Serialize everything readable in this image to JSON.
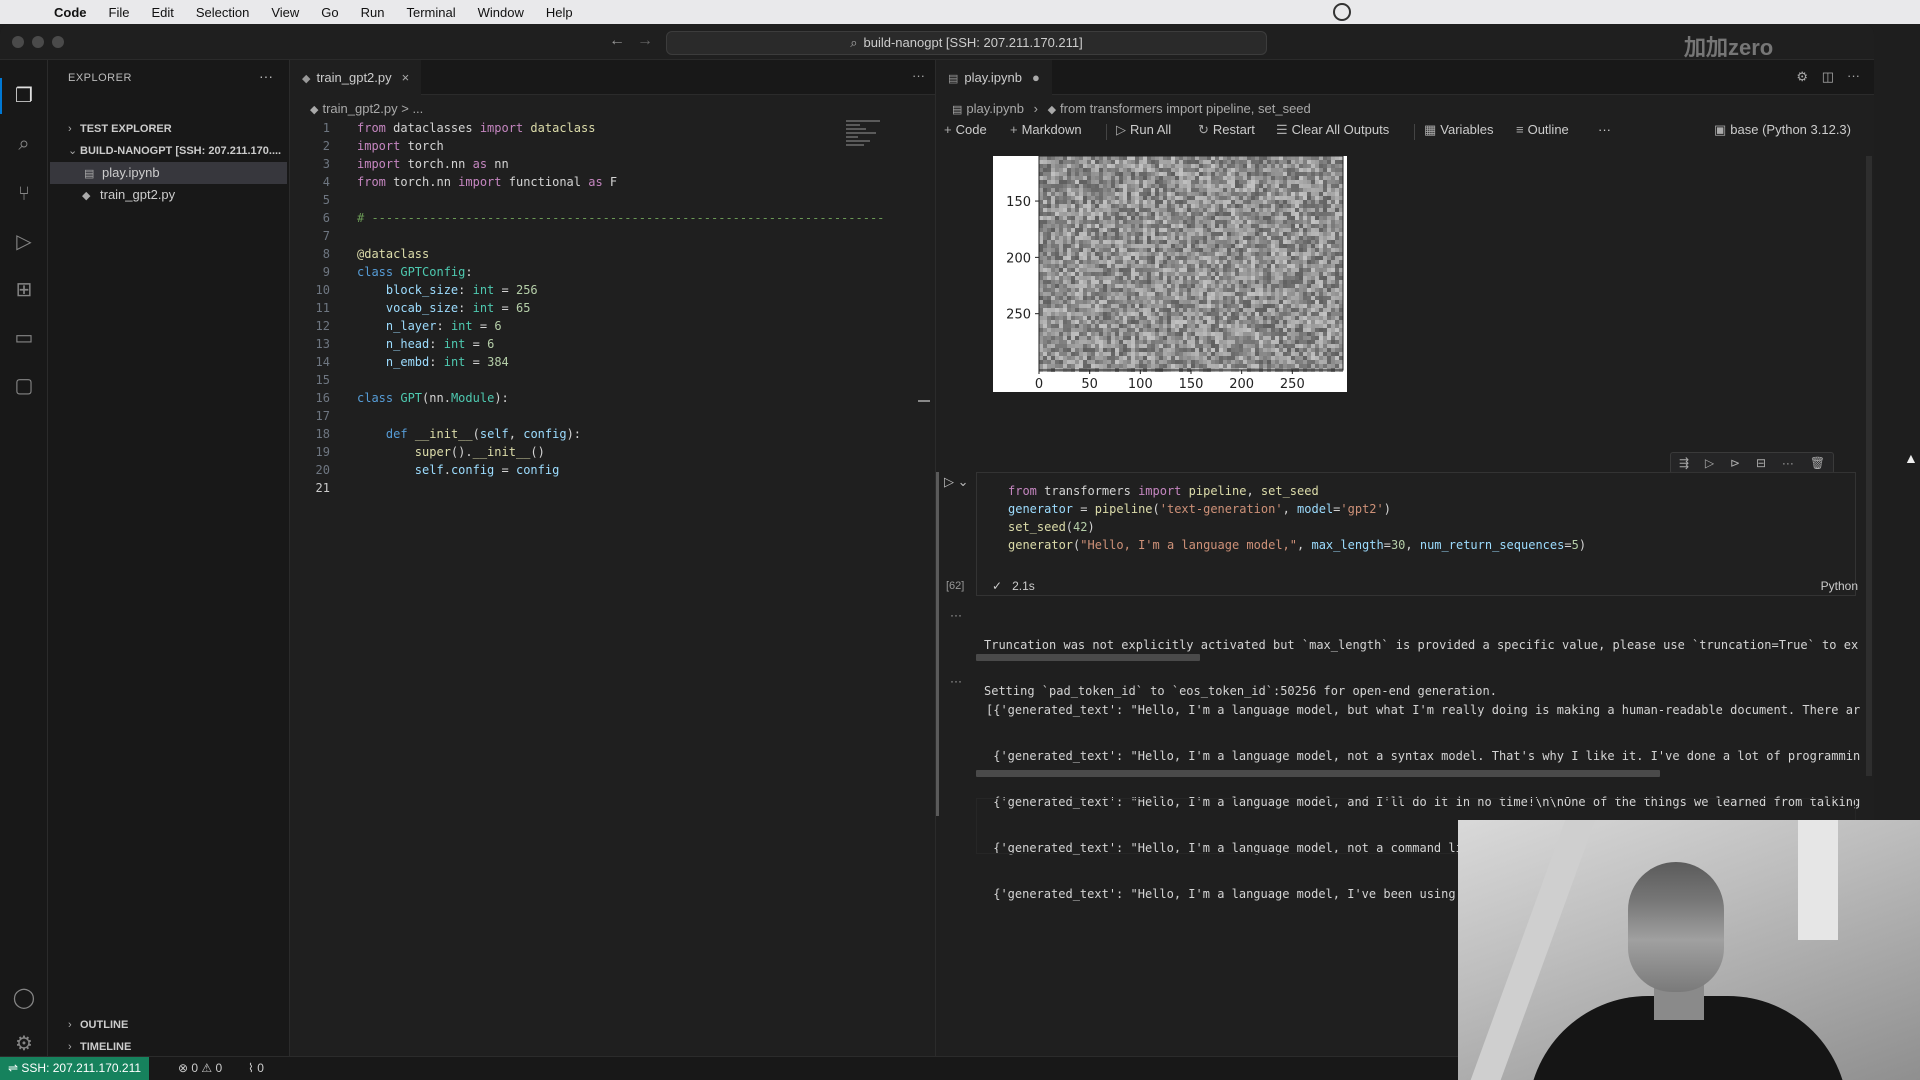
{
  "menubar": {
    "app_name": "Code",
    "items": [
      "File",
      "Edit",
      "Selection",
      "View",
      "Go",
      "Run",
      "Terminal",
      "Window",
      "Help"
    ]
  },
  "titlebar": {
    "command_center": "build-nanogpt [SSH: 207.211.170.211]"
  },
  "watermark": "加加zero",
  "sidebar": {
    "title": "EXPLORER",
    "more": "···",
    "test_explorer": "TEST EXPLORER",
    "folder": "BUILD-NANOGPT [SSH: 207.211.170....",
    "files": [
      "play.ipynb",
      "train_gpt2.py"
    ],
    "outline": "OUTLINE",
    "timeline": "TIMELINE"
  },
  "editor1": {
    "tab_label": "train_gpt2.py",
    "tab_close": "×",
    "breadcrumb": "train_gpt2.py > ...",
    "lines": [
      {
        "n": "1",
        "code": "from dataclasses import dataclass"
      },
      {
        "n": "2",
        "code": "import torch"
      },
      {
        "n": "3",
        "code": "import torch.nn as nn"
      },
      {
        "n": "4",
        "code": "from torch.nn import functional as F"
      },
      {
        "n": "5",
        "code": ""
      },
      {
        "n": "6",
        "code": "# -----------------------------------------------------------------------"
      },
      {
        "n": "7",
        "code": ""
      },
      {
        "n": "8",
        "code": "@dataclass"
      },
      {
        "n": "9",
        "code": "class GPTConfig:"
      },
      {
        "n": "10",
        "code": "    block_size: int = 256"
      },
      {
        "n": "11",
        "code": "    vocab_size: int = 65"
      },
      {
        "n": "12",
        "code": "    n_layer: int = 6"
      },
      {
        "n": "13",
        "code": "    n_head: int = 6"
      },
      {
        "n": "14",
        "code": "    n_embd: int = 384"
      },
      {
        "n": "15",
        "code": ""
      },
      {
        "n": "16",
        "code": "class GPT(nn.Module):"
      },
      {
        "n": "17",
        "code": ""
      },
      {
        "n": "18",
        "code": "    def __init__(self, config):"
      },
      {
        "n": "19",
        "code": "        super().__init__()"
      },
      {
        "n": "20",
        "code": "        self.config = config"
      },
      {
        "n": "21",
        "code": ""
      }
    ]
  },
  "editor2": {
    "tab_label": "play.ipynb",
    "breadcrumb_file": "play.ipynb",
    "breadcrumb_cell": "from transformers import pipeline, set_seed",
    "toolbar": {
      "code": "Code",
      "markdown": "Markdown",
      "run_all": "Run All",
      "restart": "Restart",
      "clear_outputs": "Clear All Outputs",
      "variables": "Variables",
      "outline": "Outline",
      "more": "···",
      "kernel": "base (Python 3.12.3)"
    },
    "cell": {
      "code_lines": [
        "from transformers import pipeline, set_seed",
        "generator = pipeline('text-generation', model='gpt2')",
        "set_seed(42)",
        "generator(\"Hello, I'm a language model,\", max_length=30, num_return_sequences=5)"
      ],
      "exec_count": "[62]",
      "exec_time": "2.1s",
      "language": "Python"
    },
    "output1": [
      "Truncation was not explicitly activated but `max_length` is provided a specific value, please use `truncation=True` to ex",
      "Setting `pad_token_id` to `eos_token_id`:50256 for open-end generation."
    ],
    "output2": [
      "[{'generated_text': \"Hello, I'm a language model, but what I'm really doing is making a human-readable document. There ar",
      " {'generated_text': \"Hello, I'm a language model, not a syntax model. That's why I like it. I've done a lot of programmin",
      " {'generated_text': \"Hello, I'm a language model, and I'll do it in no time!\\n\\nOne of the things we learned from talking",
      " {'generated_text': \"Hello, I'm a language model, not a command line tool.\\n\\nIf my code is simple enough:\\n\\nif (use (st",
      " {'generated_text': \"Hello, I'm a language model, I've been using Language in all my work. Just a small example, let's se"
    ],
    "output_more": "···"
  },
  "chart_data": {
    "type": "heatmap",
    "title": "",
    "xlabel": "",
    "ylabel": "",
    "x_ticks": [
      "0",
      "50",
      "100",
      "150",
      "200",
      "250"
    ],
    "y_ticks": [
      "150",
      "200",
      "250"
    ],
    "xlim": [
      0,
      300
    ],
    "ylim": [
      300,
      110
    ],
    "colormap": "gray",
    "visible_rows_partial": true
  },
  "statusbar": {
    "remote": "SSH: 207.211.170.211",
    "errors": "0",
    "warnings": "0",
    "ports": "0"
  },
  "colors": {
    "accent": "#0078d4",
    "remote_bg": "#16825d",
    "editor_bg": "#1f1f1f"
  }
}
